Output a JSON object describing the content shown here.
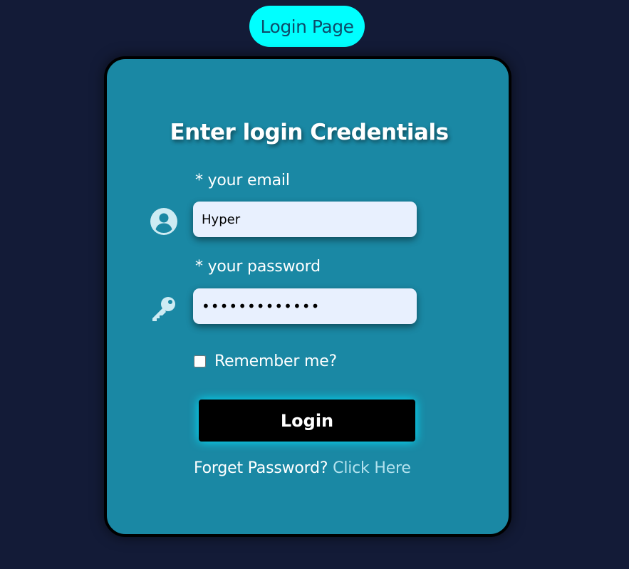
{
  "header": {
    "badge_label": "Login Page"
  },
  "card": {
    "title": "Enter login Credentials",
    "email": {
      "label": "* your email",
      "value": "Hyper",
      "icon": "user-circle-icon"
    },
    "password": {
      "label": "* your password",
      "value": "•••••••••••••",
      "icon": "key-icon"
    },
    "remember": {
      "label": "Remember me?",
      "checked": false
    },
    "login_button_label": "Login",
    "forgot": {
      "prefix": "Forget Password?",
      "link_label": "Click Here"
    }
  },
  "colors": {
    "background": "#131b37",
    "card": "#1a88a4",
    "badge": "#00ffff",
    "input": "#e8f0fe",
    "link": "#b3e2ee",
    "glow": "#00e5ff"
  }
}
